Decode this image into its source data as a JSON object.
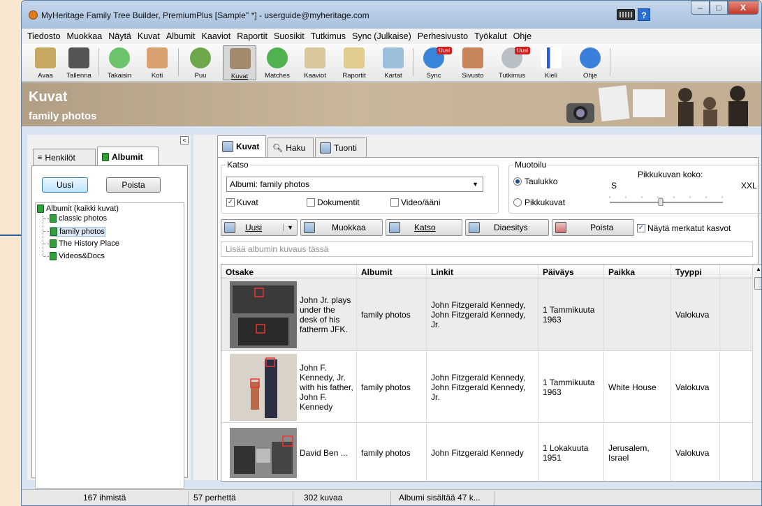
{
  "window": {
    "title": "MyHeritage Family Tree Builder, PremiumPlus [Sample'' *] - userguide@myheritage.com",
    "min": "–",
    "max": "□",
    "close": "X",
    "help": "?"
  },
  "menu": [
    "Tiedosto",
    "Muokkaa",
    "Näytä",
    "Kuvat",
    "Albumit",
    "Kaaviot",
    "Raportit",
    "Suosikit",
    "Tutkimus",
    "Sync (Julkaise)",
    "Perhesivusto",
    "Työkalut",
    "Ohje"
  ],
  "toolbar": {
    "items": [
      {
        "label": "Avaa",
        "icon": "folder-icon",
        "color": "#8a6b2e"
      },
      {
        "label": "Tallenna",
        "icon": "save-icon",
        "color": "#444444"
      },
      {
        "label": "Takaisin",
        "icon": "back-arrow-icon",
        "color": "#3aa83a"
      },
      {
        "label": "Koti",
        "icon": "home-icon",
        "color": "#c85a2a"
      },
      {
        "label": "Puu",
        "icon": "tree-icon",
        "color": "#4a9a2a"
      },
      {
        "label": "Kuvat",
        "icon": "photos-icon",
        "color": "#8a6b4e"
      },
      {
        "label": "Matches",
        "icon": "matches-icon",
        "color": "#3aa83a"
      },
      {
        "label": "Kaaviot",
        "icon": "charts-icon",
        "color": "#b8a370"
      },
      {
        "label": "Raportit",
        "icon": "reports-icon",
        "color": "#c9b06a"
      },
      {
        "label": "Kartat",
        "icon": "map-icon",
        "color": "#7fa8c8"
      },
      {
        "label": "Sync",
        "icon": "sync-icon",
        "color": "#2a6fd4"
      },
      {
        "label": "Sivusto",
        "icon": "website-icon",
        "color": "#b06a3a"
      },
      {
        "label": "Tutkimus",
        "icon": "research-icon",
        "color": "#9aa3aa"
      },
      {
        "label": "Kieli",
        "icon": "flag-icon",
        "color": "#2a5fd4"
      },
      {
        "label": "Ohje",
        "icon": "help-icon",
        "color": "#2a6fd4"
      }
    ],
    "new_badge": "Uusi"
  },
  "header": {
    "title": "Kuvat",
    "subtitle": "family photos"
  },
  "left": {
    "collapse": "<",
    "tabs": [
      "Henkilöt",
      "Albumit"
    ],
    "new_button": "Uusi",
    "delete_button": "Poista",
    "tree": [
      "Albumit (kaikki kuvat)",
      "classic photos",
      "family photos",
      "The History Place",
      "Videos&Docs"
    ]
  },
  "right": {
    "tabs": [
      "Kuvat",
      "Haku",
      "Tuonti"
    ],
    "katso": {
      "label": "Katso",
      "select": "Albumi: family photos",
      "cb_kuvat": "Kuvat",
      "cb_dokumentit": "Dokumentit",
      "cb_video": "Video/ääni"
    },
    "muotoilu": {
      "label": "Muotoilu",
      "taulukko": "Taulukko",
      "pikkukuvat": "Pikkukuvat",
      "size_label": "Pikkukuvan koko:",
      "size_min": "S",
      "size_max": "XXL"
    },
    "actions": {
      "uusi": "Uusi",
      "muokkaa": "Muokkaa",
      "katso": "Katso",
      "diaesitys": "Diaesitys",
      "poista": "Poista",
      "show_faces": "Näytä merkatut kasvot"
    },
    "desc_placeholder": "Lisää albumin kuvaus tässä",
    "columns": [
      "Otsake",
      "Albumit",
      "Linkit",
      "Päiväys",
      "Paikka",
      "Tyyppi"
    ],
    "rows": [
      {
        "title": "John Jr. plays under the desk of his fatherm JFK.",
        "album": "family photos",
        "links": "John Fitzgerald Kennedy, John Fitzgerald Kennedy, Jr.",
        "date": "1 Tammikuuta 1963",
        "place": "",
        "type": "Valokuva"
      },
      {
        "title": "John F. Kennedy, Jr. with his father, John F. Kennedy",
        "album": "family photos",
        "links": "John Fitzgerald Kennedy, John Fitzgerald Kennedy, Jr.",
        "date": "1 Tammikuuta 1963",
        "place": "White House",
        "type": "Valokuva"
      },
      {
        "title": "David Ben ...",
        "album": "family photos",
        "links": "John Fitzgerald Kennedy",
        "date": "1 Lokakuuta 1951",
        "place": "Jerusalem, Israel",
        "type": "Valokuva"
      }
    ]
  },
  "status": {
    "people": "167 ihmistä",
    "families": "57 perhettä",
    "photos": "302 kuvaa",
    "album_info": "Albumi sisältää 47 k..."
  }
}
